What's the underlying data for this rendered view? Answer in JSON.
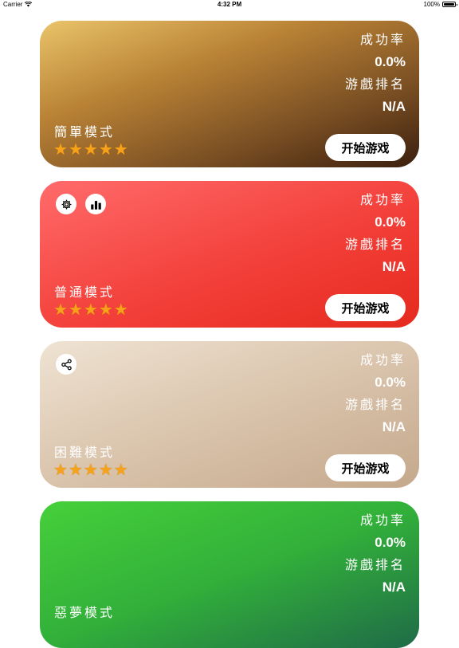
{
  "status_bar": {
    "carrier": "Carrier",
    "time": "4:32 PM",
    "battery": "100%"
  },
  "colors": {
    "star": "#f7a21b",
    "button_bg": "#ffffff",
    "button_text": "#000000"
  },
  "cards": [
    {
      "mode": "簡單模式",
      "success_label": "成功率",
      "success_value": "0.0%",
      "rank_label": "游戲排名",
      "rank_value": "N/A",
      "stars": 5,
      "start_label": "开始游戏"
    },
    {
      "mode": "普通模式",
      "success_label": "成功率",
      "success_value": "0.0%",
      "rank_label": "游戲排名",
      "rank_value": "N/A",
      "stars": 5,
      "start_label": "开始游戏",
      "icons": [
        "gear-icon",
        "leaderboard-icon"
      ]
    },
    {
      "mode": "困難模式",
      "success_label": "成功率",
      "success_value": "0.0%",
      "rank_label": "游戲排名",
      "rank_value": "N/A",
      "stars": 5,
      "start_label": "开始游戏",
      "icons": [
        "share-icon"
      ]
    },
    {
      "mode": "惡夢模式",
      "success_label": "成功率",
      "success_value": "0.0%",
      "rank_label": "游戲排名",
      "rank_value": "N/A"
    }
  ]
}
